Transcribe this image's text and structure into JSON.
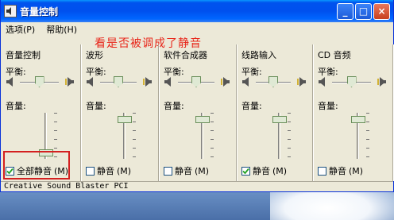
{
  "window": {
    "title": "音量控制",
    "caption_buttons": {
      "minimize": "_",
      "maximize": "□",
      "close": "×"
    }
  },
  "menu": [
    {
      "label": "选项",
      "accel": "(P)"
    },
    {
      "label": "帮助",
      "accel": "(H)"
    }
  ],
  "annotation": "看是否被调成了静音",
  "labels": {
    "balance": "平衡:",
    "volume": "音量:"
  },
  "panels": [
    {
      "title": "音量控制",
      "balance_value": 0.5,
      "volume_value": 0.1,
      "mute_label": "全部静音",
      "mute_accel": "(M)",
      "muted": true
    },
    {
      "title": "波形",
      "balance_value": 0.5,
      "volume_value": 0.85,
      "mute_label": "静音",
      "mute_accel": "(M)",
      "muted": false
    },
    {
      "title": "软件合成器",
      "balance_value": 0.5,
      "volume_value": 0.85,
      "mute_label": "静音",
      "mute_accel": "(M)",
      "muted": false
    },
    {
      "title": "线路输入",
      "balance_value": 0.5,
      "volume_value": 0.85,
      "mute_label": "静音",
      "mute_accel": "(M)",
      "muted": true
    },
    {
      "title": "CD 音频",
      "balance_value": 0.5,
      "volume_value": 0.85,
      "mute_label": "静音",
      "mute_accel": "(M)",
      "muted": false
    }
  ],
  "statusbar": "Creative Sound Blaster PCI",
  "colors": {
    "titlebar": "#0053ee",
    "annotation": "#e8261a",
    "highlight": "#d42020",
    "window_bg": "#ece9d8"
  }
}
